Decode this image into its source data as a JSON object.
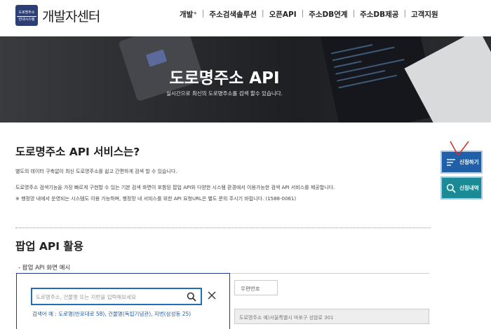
{
  "header": {
    "logo_badge_line1": "도로명주소",
    "logo_badge_line2": "안내시스템",
    "logo_text": "개발자센터",
    "nav": [
      "개발⁺",
      "주소검색솔루션",
      "오픈API",
      "주소DB연계",
      "주소DB제공",
      "고객지원"
    ],
    "nav_separator": "|"
  },
  "hero": {
    "title": "도로명주소 API",
    "subtitle": "실시간으로 최신의 도로명주소를 검색 할수 있습니다."
  },
  "intro": {
    "title": "도로명주소 API 서비스는?",
    "p1": "별도의 데이터 구축없이 최신 도로명주소를 쉽고 간편하게 검색 할 수 있습니다.",
    "p2": "도로명주소 검색기능을 가장 빠르게 구현할 수 있는 기본 검색 화면이 포함된 팝업 API와 다양한 시스템 환경에서 이용가능한 검색 API 서비스를 제공합니다.",
    "p3": "※ 행정망 내에서 운영되는 시스템도 이용 가능하며, 행정망 내 서비스를 위한 API 요청URL은 별도 문의 주시기 바랍니다. (1588-0061)"
  },
  "popup_section": {
    "title": "팝업 API 활용",
    "sub_label": "- 팝업 API 화면 예시",
    "postal_placeholder": "우편번호",
    "address_placeholder": "도로명주소 예)서울특별시 마포구 성암로 301"
  },
  "popup": {
    "search_placeholder": "도로명주소, 건물명 또는 지번을 입력해보세요",
    "example": "검색어 예 : 도로명(반포대로 58), 건물명(독립기념관), 지번(삼성동 25)"
  },
  "floating": {
    "apply_label": "신청하기",
    "status_label": "신청내역"
  },
  "colors": {
    "brand_navy": "#2c3e75",
    "apply_blue": "#1f60a8",
    "status_teal": "#1a8a95",
    "link_blue": "#1f5fa8"
  }
}
